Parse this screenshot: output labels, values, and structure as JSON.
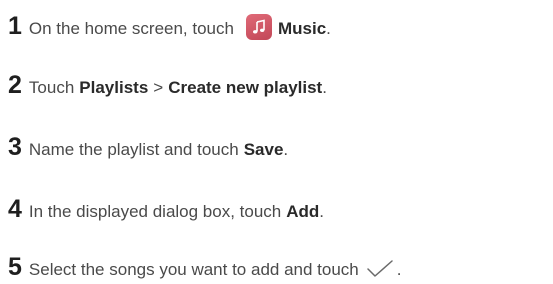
{
  "steps": [
    {
      "number": "1",
      "text_before": "On the home screen, touch",
      "bold": "Music",
      "text_after": ".",
      "icon": "music-app-icon"
    },
    {
      "number": "2",
      "text_before": "Touch",
      "bold": "Playlists",
      "sep": ">",
      "bold2": "Create new playlist",
      "text_after": "."
    },
    {
      "number": "3",
      "text_before": "Name the playlist and touch",
      "bold": "Save",
      "text_after": "."
    },
    {
      "number": "4",
      "text_before": "In the displayed dialog box, touch",
      "bold": "Add",
      "text_after": "."
    },
    {
      "number": "5",
      "text_before": "Select the songs you want to add and touch",
      "text_after": ".",
      "icon": "checkmark-icon"
    }
  ],
  "colors": {
    "icon_bg": "#d35a6a",
    "text": "#4a4a4a",
    "number": "#1f1f1f"
  }
}
